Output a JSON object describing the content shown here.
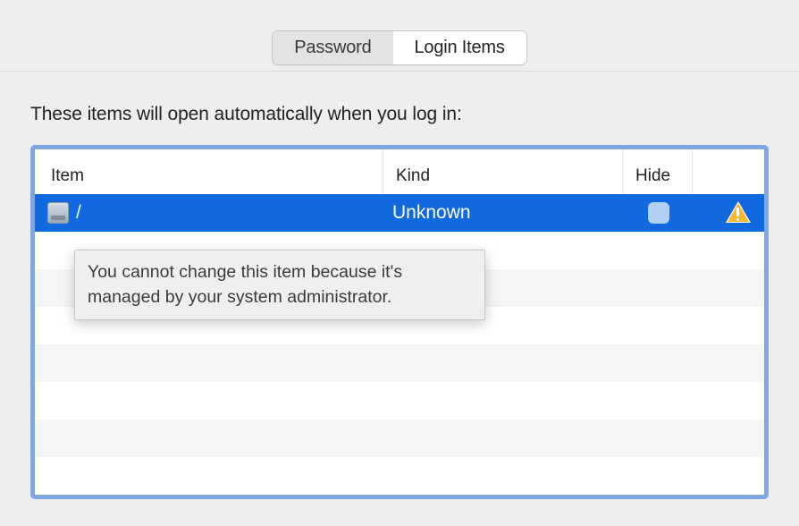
{
  "tabs": {
    "password": "Password",
    "login_items": "Login Items"
  },
  "description": "These items will open automatically when you log in:",
  "table": {
    "headers": {
      "item": "Item",
      "kind": "Kind",
      "hide": "Hide"
    },
    "rows": [
      {
        "name": "/",
        "kind": "Unknown",
        "hide_checked": false,
        "warning": true,
        "selected": true
      }
    ]
  },
  "tooltip": "You cannot change this item because it's managed by your system administrator."
}
